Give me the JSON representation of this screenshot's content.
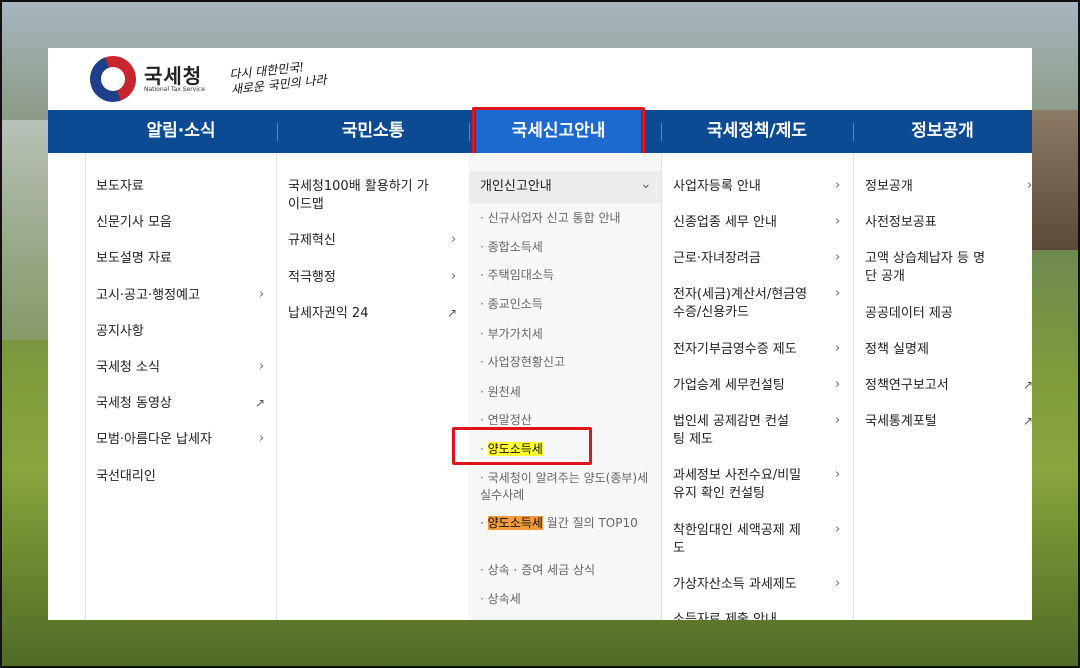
{
  "logo": {
    "name": "국세청",
    "sub": "National Tax Service",
    "slogan_line1": "다시 대한민국!",
    "slogan_line2": "새로운 국민의 나라"
  },
  "nav": [
    "알림·소식",
    "국민소통",
    "국세신고안내",
    "국세정책/제도",
    "정보공개"
  ],
  "col1": [
    "보도자료",
    "신문기사 모음",
    "보도설명 자료",
    "고시·공고·행정예고",
    "공지사항",
    "국세청 소식",
    "국세청 동영상",
    "모범·아름다운 납세자",
    "국선대리인"
  ],
  "col2": [
    "국세청100배 활용하기 가이드맵",
    "규제혁신",
    "적극행정",
    "납세자권익 24"
  ],
  "col3": {
    "head": "개인신고안내",
    "items": [
      "신규사업자 신고 통합 안내",
      "종합소득세",
      "주택임대소득",
      "종교인소득",
      "부가가치세",
      "사업장현황신고",
      "원천세",
      "연말정산",
      "양도소득세",
      "국세청이 알려주는 양도(종부)세 실수사례",
      "양도소득세",
      "월간 질의 TOP10",
      "상속 · 증여 세금 상식",
      "상속세"
    ]
  },
  "col4": [
    "사업자등록 안내",
    "신종업종 세무 안내",
    "근로·자녀장려금",
    "전자(세금)계산서/현금영수증/신용카드",
    "전자기부금영수증 제도",
    "가업승계 세무컨설팅",
    "법인세 공제감면 컨설팅 제도",
    "과세정보 사전수요/비밀유지 확인 컨설팅",
    "착한임대인 세액공제 제도",
    "가상자산소득 과세제도",
    "소득자료 제출 안내"
  ],
  "col5": [
    "정보공개",
    "사전정보공표",
    "고액 상습체납자 등 명단 공개",
    "공공데이터 제공",
    "정책 실명제",
    "정책연구보고서",
    "국세통계포털"
  ]
}
